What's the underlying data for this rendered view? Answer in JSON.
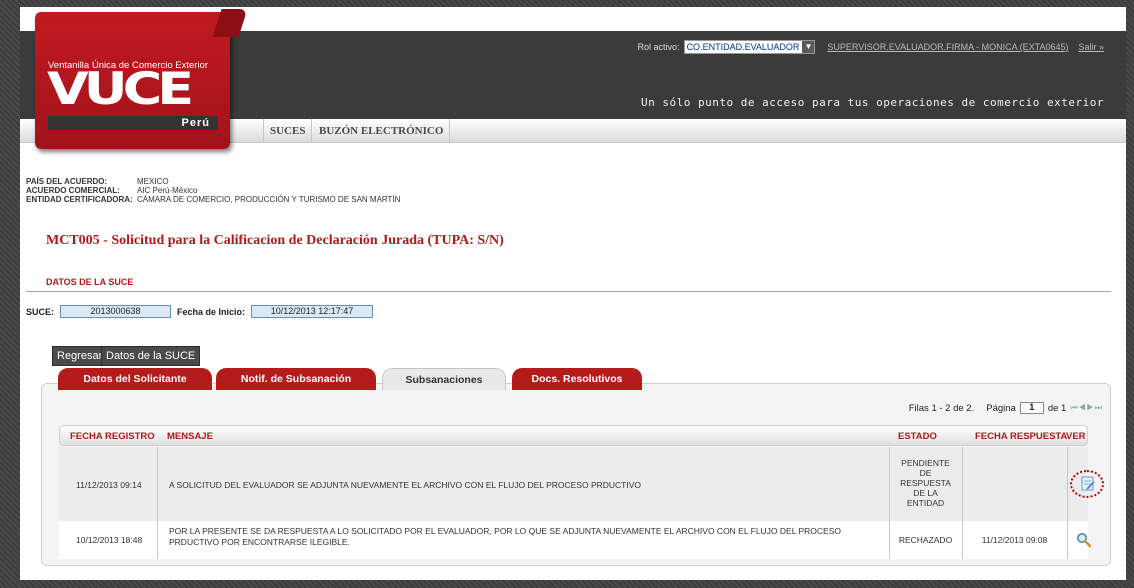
{
  "header": {
    "rol_label": "Rol activo:",
    "rol_value": "CO.ENTIDAD.EVALUADOR",
    "user_link": "SUPERVISOR.EVALUADOR.FIRMA - MONICA (EXTA0645)",
    "logout": "Salir »",
    "slogan": "Un sólo punto de acceso para tus operaciones de comercio exterior"
  },
  "logo": {
    "tagline": "Ventanilla Única de Comercio Exterior",
    "name": "VUCE",
    "country": "Perú"
  },
  "nav": {
    "items": [
      "SUCES",
      "BUZÓN ELECTRÓNICO"
    ]
  },
  "info": {
    "pais_label": "PAÍS DEL ACUERDO:",
    "pais_value": "MEXICO",
    "acuerdo_label": "ACUERDO COMERCIAL:",
    "acuerdo_value": "AIC Perú-México",
    "entidad_label": "ENTIDAD CERTIFICADORA:",
    "entidad_value": "CÁMARA DE COMERCIO, PRODUCCIÓN Y TURISMO DE SAN MARTÍN"
  },
  "form_title": "MCT005 - Solicitud para la Calificacion de Declaración Jurada (TUPA: S/N)",
  "section": {
    "title": "DATOS DE LA SUCE",
    "suce_label": "SUCE:",
    "suce_value": "2013000638",
    "fecha_label": "Fecha de Inicio:",
    "fecha_value": "10/12/2013 12:17:47"
  },
  "buttons": {
    "regresar": "Regresar",
    "datos_suce": "Datos de la SUCE"
  },
  "tabs": [
    "Datos del Solicitante",
    "Notif. de Subsanación",
    "Subsanaciones",
    "Docs. Resolutivos"
  ],
  "active_tab": "Subsanaciones",
  "pager": {
    "rows": "Filas 1 - 2 de 2.",
    "page_label": "Página",
    "page": "1",
    "of": "de 1"
  },
  "table": {
    "headers": [
      "FECHA REGISTRO",
      "MENSAJE",
      "ESTADO",
      "FECHA RESPUESTA",
      "VER"
    ],
    "rows": [
      {
        "fecha": "11/12/2013 09:14",
        "mensaje": "A SOLICITUD DEL EVALUADOR SE ADJUNTA NUEVAMENTE EL ARCHIVO CON EL FLUJO DEL PROCESO PRDUCTIVO",
        "estado": [
          "PENDIENTE",
          "DE",
          "RESPUESTA",
          "DE LA",
          "ENTIDAD"
        ],
        "fecha_respuesta": "",
        "ver_icon": "edit-document-icon"
      },
      {
        "fecha": "10/12/2013 18:48",
        "mensaje": "POR LA PRESENTE SE DA RESPUESTA A LO SOLICITADO POR EL EVALUADOR, POR LO QUE SE ADJUNTA NUEVAMENTE EL ARCHIVO CON EL FLUJO DEL PROCESO PRDUCTIVO POR ENCONTRARSE ILEGIBLE.",
        "estado": [
          "RECHAZADO"
        ],
        "fecha_respuesta": "11/12/2013 09:08",
        "ver_icon": "magnifier-icon"
      }
    ]
  },
  "colors": {
    "brand_red": "#b41b1b",
    "header_dark": "#3b3b3b",
    "field_blue": "#dbe9f7"
  }
}
